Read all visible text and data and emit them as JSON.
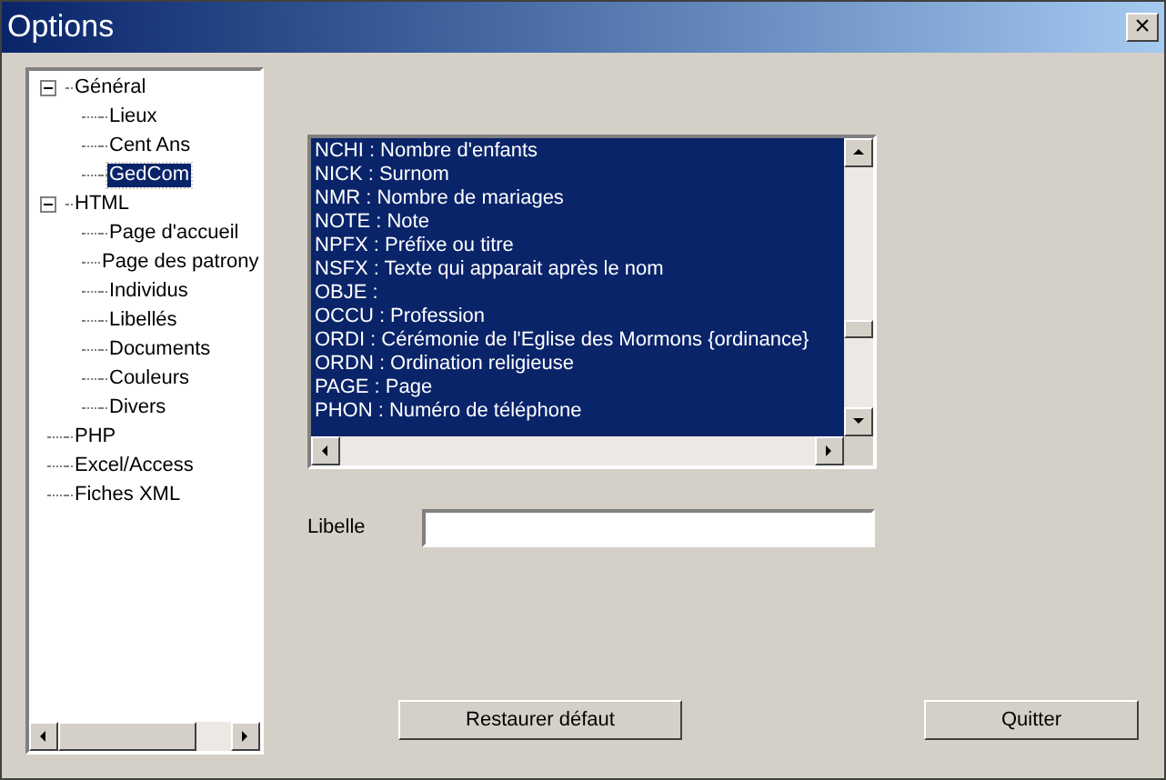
{
  "window": {
    "title": "Options",
    "close": "×"
  },
  "tree": [
    {
      "label": "Général",
      "expanded": true,
      "selected": false,
      "children": [
        {
          "label": "Lieux",
          "selected": false
        },
        {
          "label": "Cent Ans",
          "selected": false
        },
        {
          "label": "GedCom",
          "selected": true
        }
      ]
    },
    {
      "label": "HTML",
      "expanded": true,
      "selected": false,
      "children": [
        {
          "label": "Page d'accueil",
          "selected": false
        },
        {
          "label": "Page des patrony",
          "selected": false
        },
        {
          "label": "Individus",
          "selected": false
        },
        {
          "label": "Libellés",
          "selected": false
        },
        {
          "label": "Documents",
          "selected": false
        },
        {
          "label": "Couleurs",
          "selected": false
        },
        {
          "label": "Divers",
          "selected": false
        }
      ]
    },
    {
      "label": "PHP",
      "selected": false
    },
    {
      "label": "Excel/Access",
      "selected": false
    },
    {
      "label": "Fiches XML",
      "selected": false
    }
  ],
  "list": [
    {
      "text": "NCHI : Nombre d'enfants",
      "selected": true
    },
    {
      "text": "NICK : Surnom",
      "selected": true
    },
    {
      "text": "NMR : Nombre de mariages",
      "selected": true
    },
    {
      "text": "NOTE : Note",
      "selected": true
    },
    {
      "text": "NPFX : Préfixe ou titre",
      "selected": true
    },
    {
      "text": "NSFX : Texte qui apparait après le nom",
      "selected": true
    },
    {
      "text": "OBJE :",
      "selected": true
    },
    {
      "text": "OCCU : Profession",
      "selected": true
    },
    {
      "text": "ORDI : Cérémonie de l'Eglise des Mormons {ordinance}",
      "selected": true
    },
    {
      "text": "ORDN : Ordination religieuse",
      "selected": true
    },
    {
      "text": "PAGE : Page",
      "selected": true
    },
    {
      "text": "PHON : Numéro de téléphone",
      "selected": true
    }
  ],
  "libelle": {
    "label": "Libelle"
  },
  "buttons": [
    "Restaurer défaut",
    "Quitter"
  ]
}
